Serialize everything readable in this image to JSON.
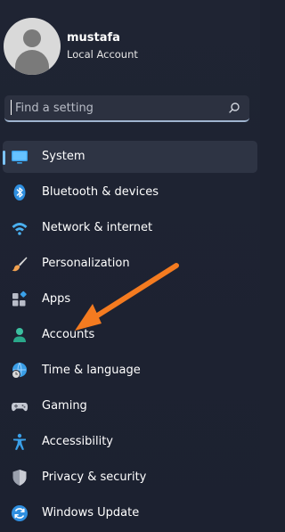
{
  "profile": {
    "name": "mustafa",
    "account_type": "Local Account"
  },
  "search": {
    "placeholder": "Find a setting",
    "icon": "search-icon"
  },
  "nav": {
    "items": [
      {
        "label": "System",
        "icon": "monitor-icon",
        "selected": true
      },
      {
        "label": "Bluetooth & devices",
        "icon": "bluetooth-icon",
        "selected": false
      },
      {
        "label": "Network & internet",
        "icon": "wifi-icon",
        "selected": false
      },
      {
        "label": "Personalization",
        "icon": "paintbrush-icon",
        "selected": false
      },
      {
        "label": "Apps",
        "icon": "apps-icon",
        "selected": false
      },
      {
        "label": "Accounts",
        "icon": "person-icon",
        "selected": false
      },
      {
        "label": "Time & language",
        "icon": "globe-clock-icon",
        "selected": false
      },
      {
        "label": "Gaming",
        "icon": "gamepad-icon",
        "selected": false
      },
      {
        "label": "Accessibility",
        "icon": "accessibility-icon",
        "selected": false
      },
      {
        "label": "Privacy & security",
        "icon": "shield-icon",
        "selected": false
      },
      {
        "label": "Windows Update",
        "icon": "update-icon",
        "selected": false
      }
    ]
  },
  "annotation": {
    "arrow_color": "#f47b20",
    "points_to": "Accounts"
  },
  "colors": {
    "background": "#1d2230",
    "selected_bg": "#2e3444",
    "accent": "#7cc4ff"
  }
}
